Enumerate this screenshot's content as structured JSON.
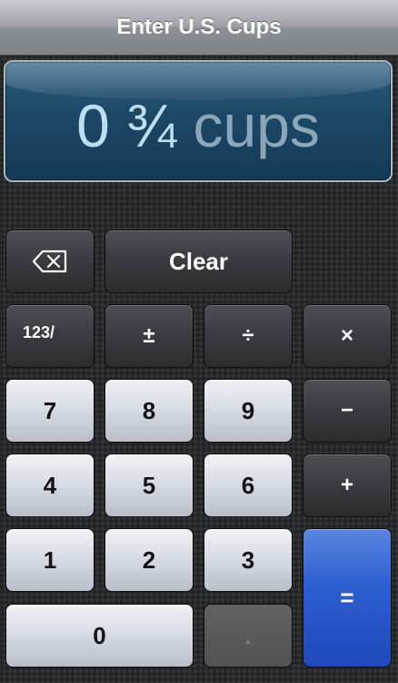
{
  "title": "Enter U.S. Cups",
  "display": {
    "whole": "0",
    "fraction": "¾",
    "unit": "cups"
  },
  "keys": {
    "clear": "Clear",
    "fraction_mode": "123/",
    "plus_minus": "±",
    "divide": "÷",
    "multiply": "×",
    "minus": "−",
    "plus": "+",
    "equals": "=",
    "decimal": ".",
    "d0": "0",
    "d1": "1",
    "d2": "2",
    "d3": "3",
    "d4": "4",
    "d5": "5",
    "d6": "6",
    "d7": "7",
    "d8": "8",
    "d9": "9"
  },
  "colors": {
    "accent_blue": "#2e5fd0",
    "display_bg": "#1c4866",
    "display_text": "#bcdff3"
  },
  "icons": {
    "backspace": "backspace-icon"
  }
}
